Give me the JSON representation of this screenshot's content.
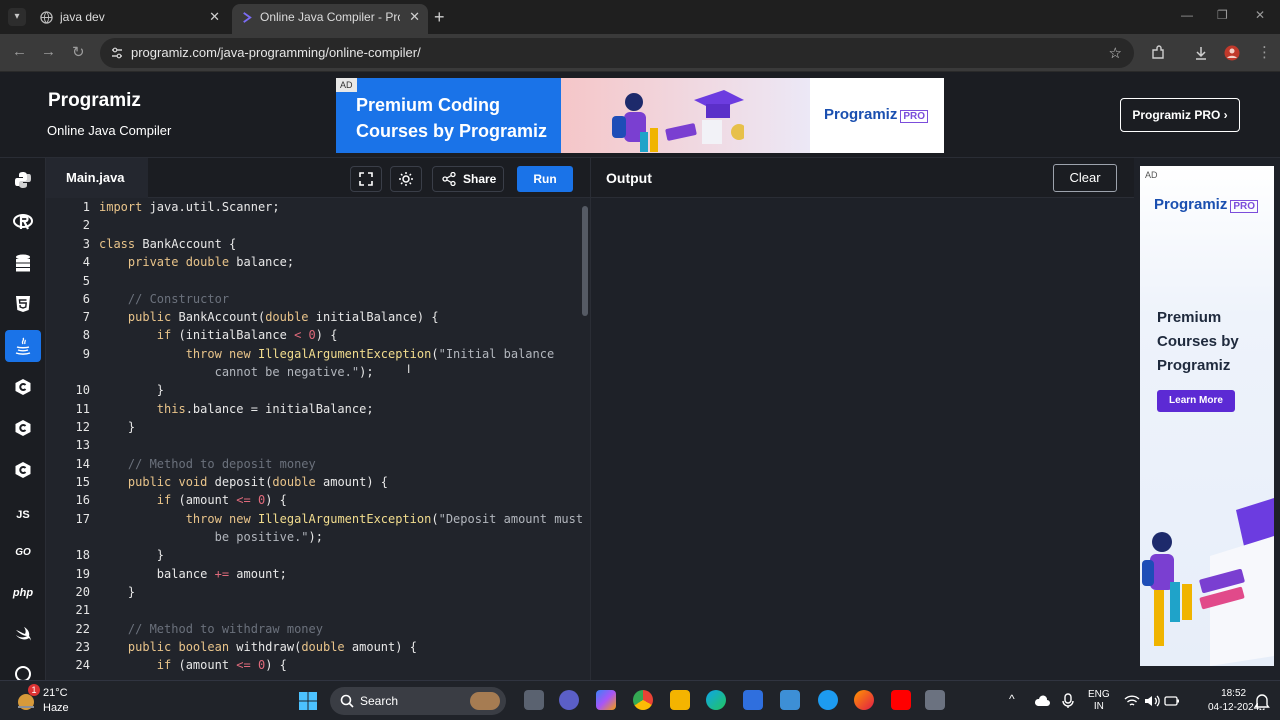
{
  "browser": {
    "tabs": [
      {
        "label": "java dev",
        "active": false
      },
      {
        "label": "Online Java Compiler - Program",
        "active": true
      }
    ],
    "url": "programiz.com/java-programming/online-compiler/"
  },
  "header": {
    "logo": "Programiz",
    "subtitle": "Online Java Compiler",
    "pro_button": "Programiz PRO ›",
    "banner": {
      "ad_label": "AD",
      "headline": "Premium Coding Courses by Programiz",
      "logo": "Programiz",
      "pro_badge": "PRO"
    }
  },
  "sidebar": {
    "languages": [
      {
        "name": "python",
        "label": ""
      },
      {
        "name": "r",
        "label": ""
      },
      {
        "name": "sql",
        "label": ""
      },
      {
        "name": "html",
        "label": ""
      },
      {
        "name": "java",
        "label": "",
        "active": true
      },
      {
        "name": "c",
        "label": ""
      },
      {
        "name": "cpp",
        "label": ""
      },
      {
        "name": "csharp",
        "label": ""
      },
      {
        "name": "js",
        "label": "JS"
      },
      {
        "name": "go",
        "label": "GO"
      },
      {
        "name": "php",
        "label": "php"
      },
      {
        "name": "swift",
        "label": ""
      },
      {
        "name": "rust",
        "label": ""
      }
    ]
  },
  "editor": {
    "file_tab": "Main.java",
    "share_label": "Share",
    "run_label": "Run",
    "line_numbers": [
      "1",
      "2",
      "3",
      "4",
      "5",
      "6",
      "7",
      "8",
      "9",
      "10",
      "11",
      "12",
      "13",
      "14",
      "15",
      "16",
      "17",
      "18",
      "19",
      "20",
      "21",
      "22",
      "23",
      "24"
    ]
  },
  "output": {
    "title": "Output",
    "clear_label": "Clear"
  },
  "side_ad": {
    "ad_label": "AD",
    "logo": "Programiz",
    "pro_badge": "PRO",
    "headline": "Premium Courses by Programiz",
    "cta": "Learn More"
  },
  "taskbar": {
    "weather_temp": "21°C",
    "weather_cond": "Haze",
    "notification_count": "1",
    "search_label": "Search",
    "lang_line1": "ENG",
    "lang_line2": "IN",
    "time": "18:52",
    "date": "04-12-2024"
  },
  "colors": {
    "accent": "#1a73e8",
    "editor_bg": "#21242b",
    "keyword": "#e9c48a",
    "comment": "#6b717c"
  }
}
